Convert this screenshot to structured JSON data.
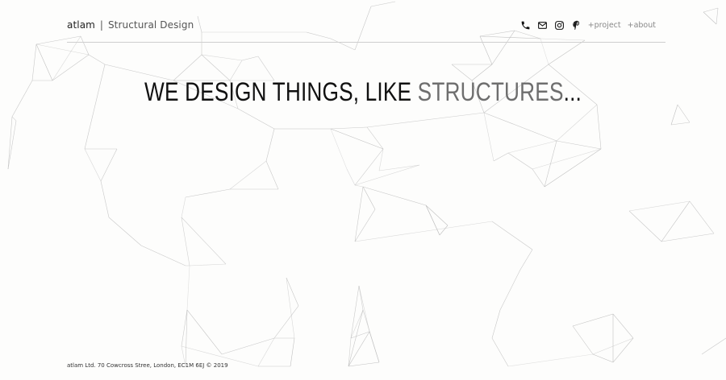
{
  "header": {
    "brand_name": "atlam",
    "brand_separator": "|",
    "brand_subtitle": "Structural Design"
  },
  "nav": {
    "icons": [
      "phone-icon",
      "mail-icon",
      "instagram-icon",
      "pinterest-icon"
    ],
    "links": [
      "+project",
      "+about"
    ]
  },
  "hero": {
    "lead": "WE DESIGN THINGS, LIKE ",
    "accent": "STRUCTURES",
    "tail": "..."
  },
  "footer": {
    "text": "atlam Ltd. 70 Cowcross Stree, London, EC1M 6EJ © 2019"
  },
  "colors": {
    "background": "#fdfdfc",
    "text": "#111111",
    "accent": "#6e6e6e",
    "rule": "#cfcfcf",
    "network_lines": "#b8b8b8"
  }
}
